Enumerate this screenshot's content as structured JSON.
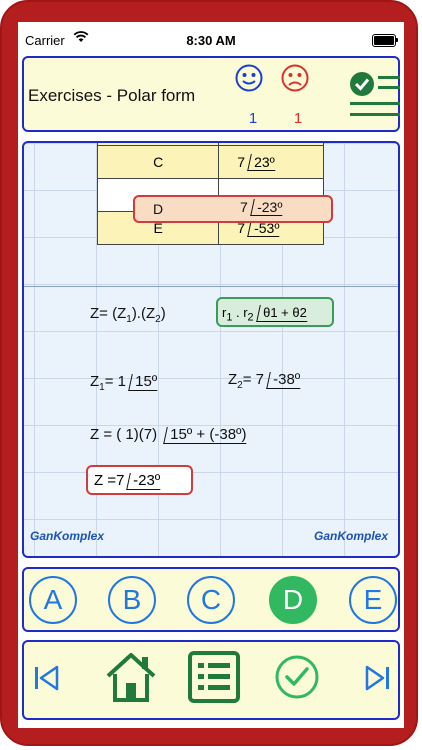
{
  "status": {
    "carrier": "Carrier",
    "time": "8:30 AM"
  },
  "header": {
    "title": "Exercises - Polar form",
    "correct_count": "1",
    "wrong_count": "1"
  },
  "table": {
    "rows": [
      {
        "label": "C",
        "magnitude": "7",
        "angle": "23º"
      },
      {
        "label": "D",
        "magnitude": "7",
        "angle": "-23º"
      },
      {
        "label": "E",
        "magnitude": "7",
        "angle": "-53º"
      }
    ]
  },
  "work": {
    "eq1_text": "Z= (Z",
    "eq1_sub1": "1",
    "eq1_mid": ").(Z",
    "eq1_sub2": "2",
    "eq1_end": ")",
    "rule_text": "r",
    "rule_sub1": "1",
    "rule_dot": " . r",
    "rule_sub2": "2",
    "rule_angle": "θ1 + θ2",
    "z1_prefix": "Z",
    "z1_sub": "1",
    "z1_value": "= 1",
    "z1_angle": "15º",
    "z2_prefix": "Z",
    "z2_sub": "2",
    "z2_value": "= 7",
    "z2_angle": "-38º",
    "eq3_text": "Z = ( 1)(7)",
    "eq3_angle": "15º + (-38º)",
    "result_text": "Z =7",
    "result_angle": "-23º",
    "brand_left": "GanKomplex",
    "brand_right": "GanKomplex"
  },
  "choices": [
    {
      "label": "A",
      "active": false
    },
    {
      "label": "B",
      "active": false
    },
    {
      "label": "C",
      "active": false
    },
    {
      "label": "D",
      "active": true
    },
    {
      "label": "E",
      "active": false
    }
  ],
  "colors": {
    "panel_border": "#1f2bc9",
    "panel_bg": "#fbfbd8",
    "choice_blue": "#2277e0",
    "correct_green": "#31b860",
    "wrong_red": "#d03b3b",
    "phone_red": "#b51e1e"
  },
  "icons": {
    "nav": [
      "first-icon",
      "home-icon",
      "list-icon",
      "check-icon",
      "last-icon"
    ]
  }
}
